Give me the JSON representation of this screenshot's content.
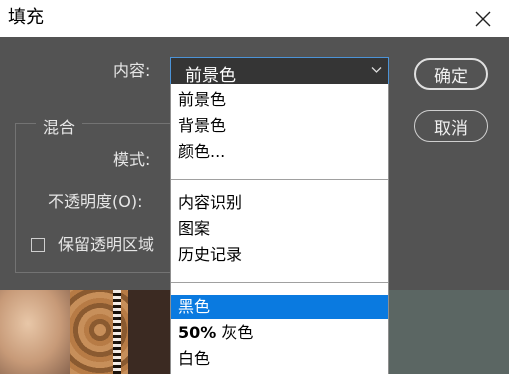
{
  "window": {
    "title": "填充"
  },
  "content": {
    "label": "内容:",
    "selected": "前景色"
  },
  "buttons": {
    "ok": "确定",
    "cancel": "取消"
  },
  "blend": {
    "group_title": "混合",
    "mode_label": "模式:",
    "opacity_label": "不透明度(O):",
    "preserve_label": "保留透明区域"
  },
  "dropdown": {
    "group1": [
      "前景色",
      "背景色",
      "颜色..."
    ],
    "group2": [
      "内容识别",
      "图案",
      "历史记录"
    ],
    "group3": {
      "black": "黑色",
      "gray_pct": "50%",
      "gray_word": "灰色",
      "white": "白色"
    },
    "highlighted": "黑色"
  },
  "colors": {
    "accent": "#0a7ae0",
    "dialog_bg": "#535353",
    "field_border": "#4c93d7"
  },
  "icons": {
    "close": "close-icon",
    "dropdown": "chevron-down-icon"
  }
}
